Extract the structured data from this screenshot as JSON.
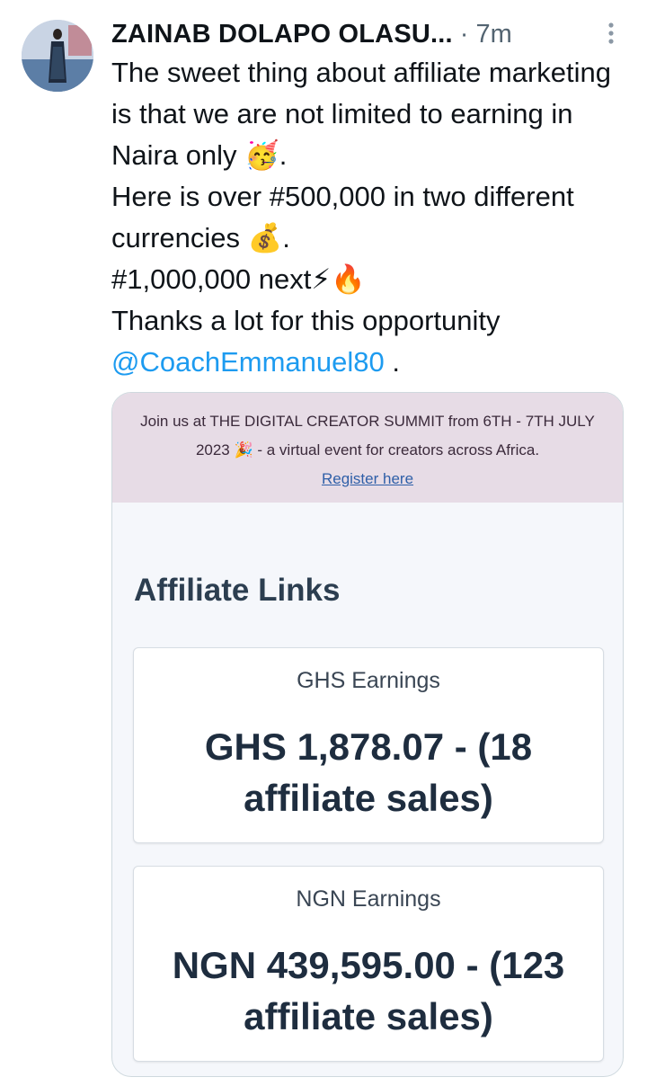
{
  "tweet": {
    "author": "ZAINAB DOLAPO OLASU...",
    "separator": "·",
    "time": "7m",
    "lines": [
      "The sweet thing about affiliate marketing is that we are not limited to earning in Naira only 🥳.",
      "Here is over #500,000 in two different currencies 💰.",
      "#1,000,000 next⚡🔥",
      "Thanks a lot for this opportunity"
    ],
    "mention": "@CoachEmmanuel80",
    "mention_tail": " ."
  },
  "card": {
    "banner_text": "Join us at THE DIGITAL CREATOR SUMMIT from 6TH - 7TH JULY 2023 🎉 - a virtual event for creators across Africa.",
    "banner_link": "Register here",
    "title": "Affiliate Links",
    "earnings": [
      {
        "label": "GHS Earnings",
        "value": "GHS 1,878.07 - (18 affiliate sales)"
      },
      {
        "label": "NGN Earnings",
        "value": "NGN 439,595.00 - (123 affiliate sales)"
      }
    ]
  },
  "icons": {
    "more": "more-vertical-icon"
  }
}
